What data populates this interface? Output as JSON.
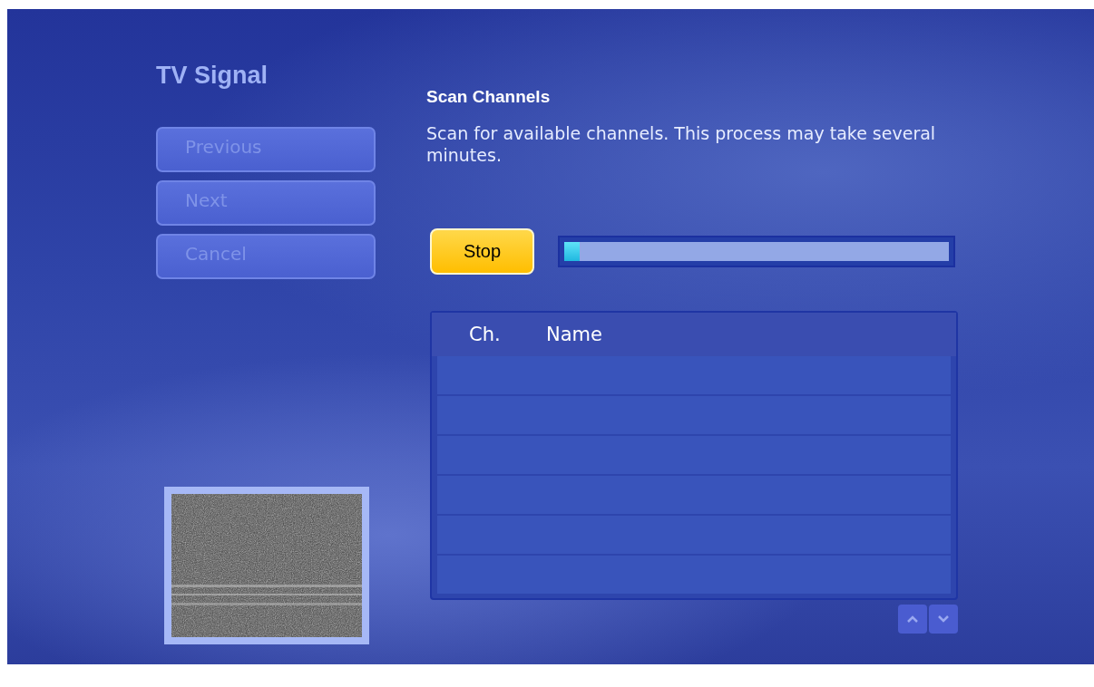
{
  "title": "TV Signal",
  "nav_buttons": [
    {
      "label": "Previous",
      "disabled": true
    },
    {
      "label": "Next",
      "disabled": true
    },
    {
      "label": "Cancel",
      "disabled": true
    }
  ],
  "heading": "Scan Channels",
  "description": "Scan for available channels. This process may take several minutes.",
  "stop_button": {
    "label": "Stop",
    "focused": true
  },
  "progress": {
    "level": 0.04
  },
  "table": {
    "columns": [
      "Ch.",
      "Name"
    ]
  }
}
